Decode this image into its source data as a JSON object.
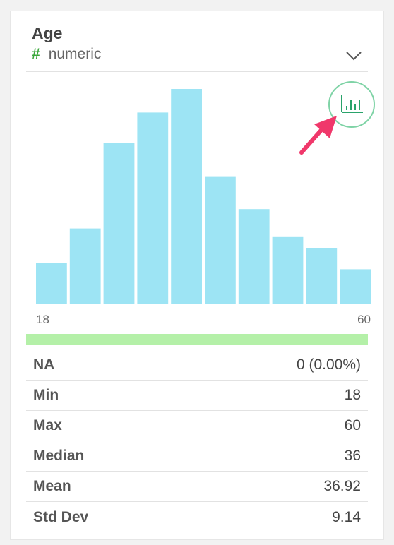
{
  "column": {
    "name": "Age",
    "type_icon": "#",
    "type_label": "numeric"
  },
  "icons": {
    "expand": "chevron-down-icon",
    "chart": "bar-chart-icon"
  },
  "colors": {
    "bars": "#9de4f4",
    "type_icon": "#3da83d",
    "chart_button_border": "#7fd3a6",
    "chart_icon": "#2aa36b",
    "arrow": "#f0386b",
    "quality_bar": "#b4f0a8"
  },
  "chart_data": {
    "type": "bar",
    "bin_range": [
      18,
      60
    ],
    "relative_heights": [
      0.19,
      0.35,
      0.75,
      0.89,
      1.0,
      0.59,
      0.44,
      0.31,
      0.26,
      0.16
    ],
    "x_tick_labels": [
      "18",
      "60"
    ],
    "ylabel": "",
    "xlabel": ""
  },
  "axis": {
    "min_label": "18",
    "max_label": "60"
  },
  "stats": [
    {
      "label": "NA",
      "value": "0 (0.00%)"
    },
    {
      "label": "Min",
      "value": "18"
    },
    {
      "label": "Max",
      "value": "60"
    },
    {
      "label": "Median",
      "value": "36"
    },
    {
      "label": "Mean",
      "value": "36.92"
    },
    {
      "label": "Std Dev",
      "value": "9.14"
    }
  ]
}
